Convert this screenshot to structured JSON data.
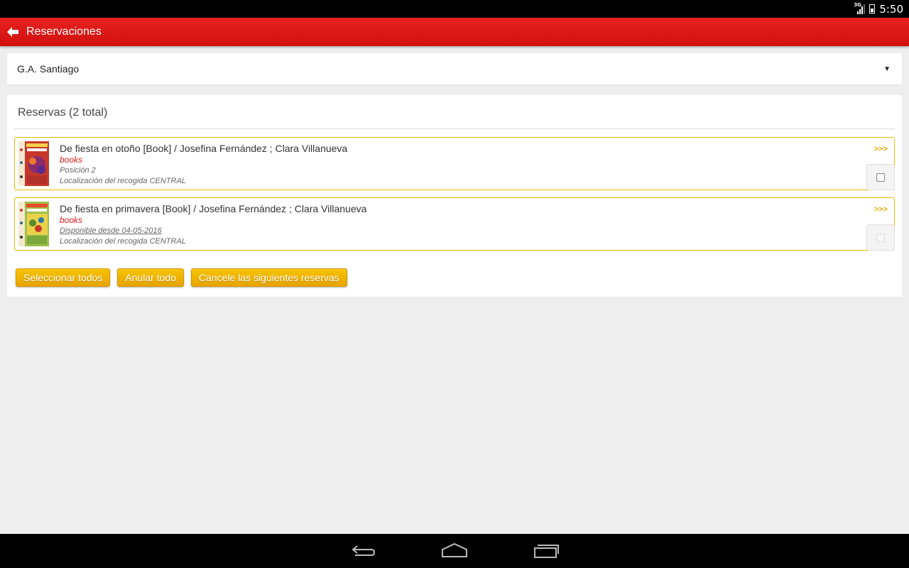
{
  "status_bar": {
    "network_label": "3G",
    "time": "5:50"
  },
  "app_bar": {
    "title": "Reservaciones",
    "back_icon": "arrow-left-icon"
  },
  "location_selector": {
    "selected": "G.A. Santiago"
  },
  "reservations": {
    "title": "Reservas (2 total)",
    "more_label": ">>>",
    "items": [
      {
        "title": "De fiesta en otoño [Book] / Josefina Fernández ; Clara Villanueva",
        "type": "books",
        "status": "Posición 2",
        "pickup": "Localización del recogida CENTRAL",
        "selectable": true
      },
      {
        "title": "De fiesta en primavera [Book] / Josefina Fernández ; Clara Villanueva",
        "type": "books",
        "status": "Disponible desde 04-05-2016",
        "pickup": "Localización del recogida CENTRAL",
        "selectable": false
      }
    ],
    "buttons": {
      "select_all": "Seleccionar todos",
      "clear_all": "Anular todo",
      "cancel_selected": "Cancele las siguientes reservas"
    }
  },
  "colors": {
    "app_bar": "#e01a1a",
    "accent": "#f0b000",
    "item_type": "#e0191b"
  }
}
